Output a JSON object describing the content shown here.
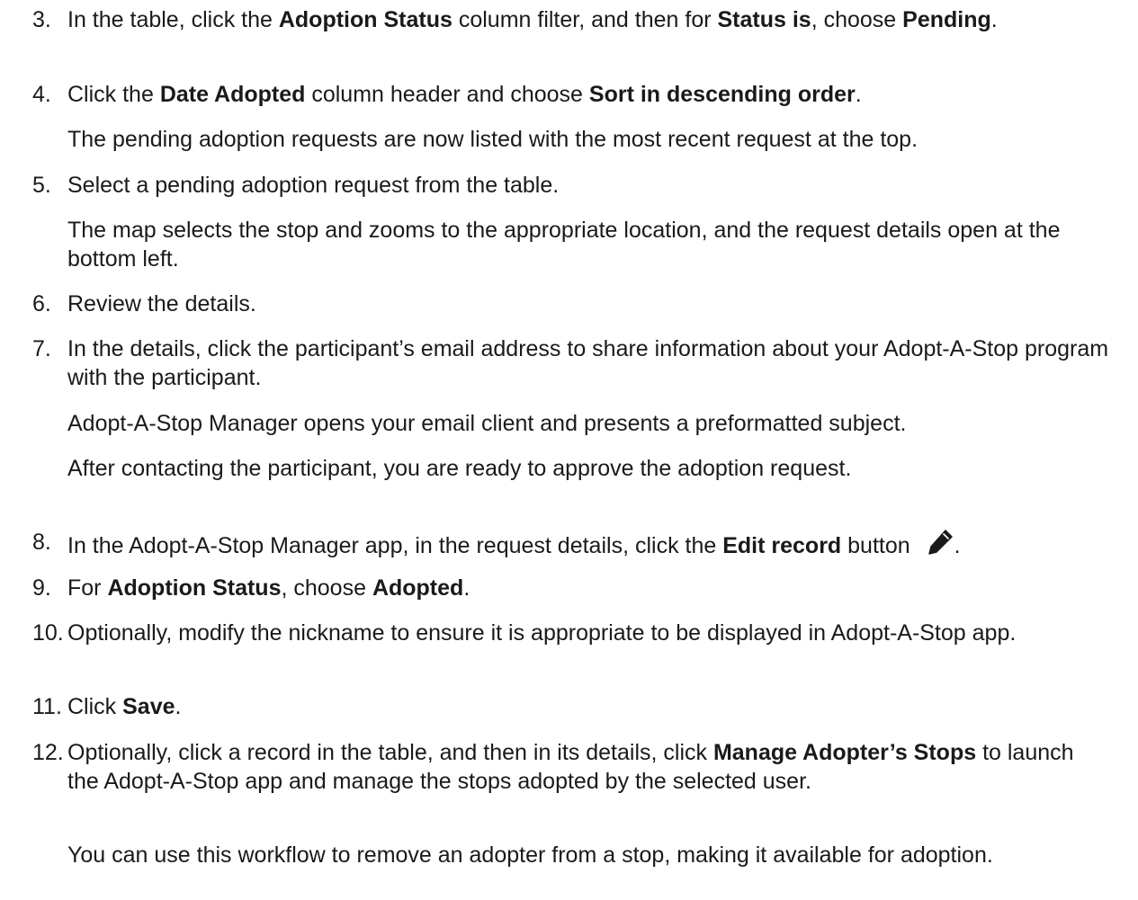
{
  "steps": [
    {
      "num": "3.",
      "segments": [
        {
          "t": "In the table, click the "
        },
        {
          "t": "Adoption Status",
          "b": true
        },
        {
          "t": " column filter, and then for "
        },
        {
          "t": "Status is",
          "b": true
        },
        {
          "t": ", choose "
        },
        {
          "t": "Pending",
          "b": true
        },
        {
          "t": "."
        }
      ]
    },
    {
      "num": "4.",
      "segments": [
        {
          "t": "Click the "
        },
        {
          "t": "Date Adopted",
          "b": true
        },
        {
          "t": " column header and choose "
        },
        {
          "t": "Sort in descending order",
          "b": true
        },
        {
          "t": "."
        }
      ]
    },
    {
      "num": "5.",
      "segments": [
        {
          "t": "Select a pending adoption request from the table."
        }
      ]
    },
    {
      "num": "6.",
      "segments": [
        {
          "t": "Review the details."
        }
      ]
    },
    {
      "num": "7.",
      "segments": [
        {
          "t": "In the details, click the participant’s email address to share information about your Adopt-A-Stop program with the participant."
        }
      ]
    },
    {
      "num": "8.",
      "segments": [
        {
          "t": "In the Adopt-A-Stop Manager app, in the request details, click the "
        },
        {
          "t": "Edit record",
          "b": true
        },
        {
          "t": " button "
        },
        {
          "icon": "pencil-icon"
        },
        {
          "t": "."
        }
      ]
    },
    {
      "num": "9.",
      "segments": [
        {
          "t": "For "
        },
        {
          "t": "Adoption Status",
          "b": true
        },
        {
          "t": ", choose "
        },
        {
          "t": "Adopted",
          "b": true
        },
        {
          "t": "."
        }
      ]
    },
    {
      "num": "10.",
      "segments": [
        {
          "t": "Optionally, modify the nickname to ensure it is appropriate to be displayed in Adopt-A-Stop app."
        }
      ]
    },
    {
      "num": "11.",
      "segments": [
        {
          "t": "Click "
        },
        {
          "t": "Save",
          "b": true
        },
        {
          "t": "."
        }
      ]
    },
    {
      "num": "12.",
      "segments": [
        {
          "t": "Optionally, click a record in the table, and then in its details, click "
        },
        {
          "t": "Manage Adopter’s Stops",
          "b": true
        },
        {
          "t": " to launch the Adopt-A-Stop app and manage the stops adopted by the selected user."
        }
      ]
    }
  ],
  "paras": [
    "The pending adoption requests are now listed with the most recent request at the top.",
    "The map selects the stop and zooms to the appropriate location, and the request details open at the bottom left.",
    "Adopt-A-Stop Manager opens your email client and presents a preformatted subject.",
    "After contacting the participant, you are ready to approve the adoption request.",
    "You can use this workflow to remove an adopter from a stop, making it available for adoption."
  ],
  "icon_color": "#1a1a1a"
}
